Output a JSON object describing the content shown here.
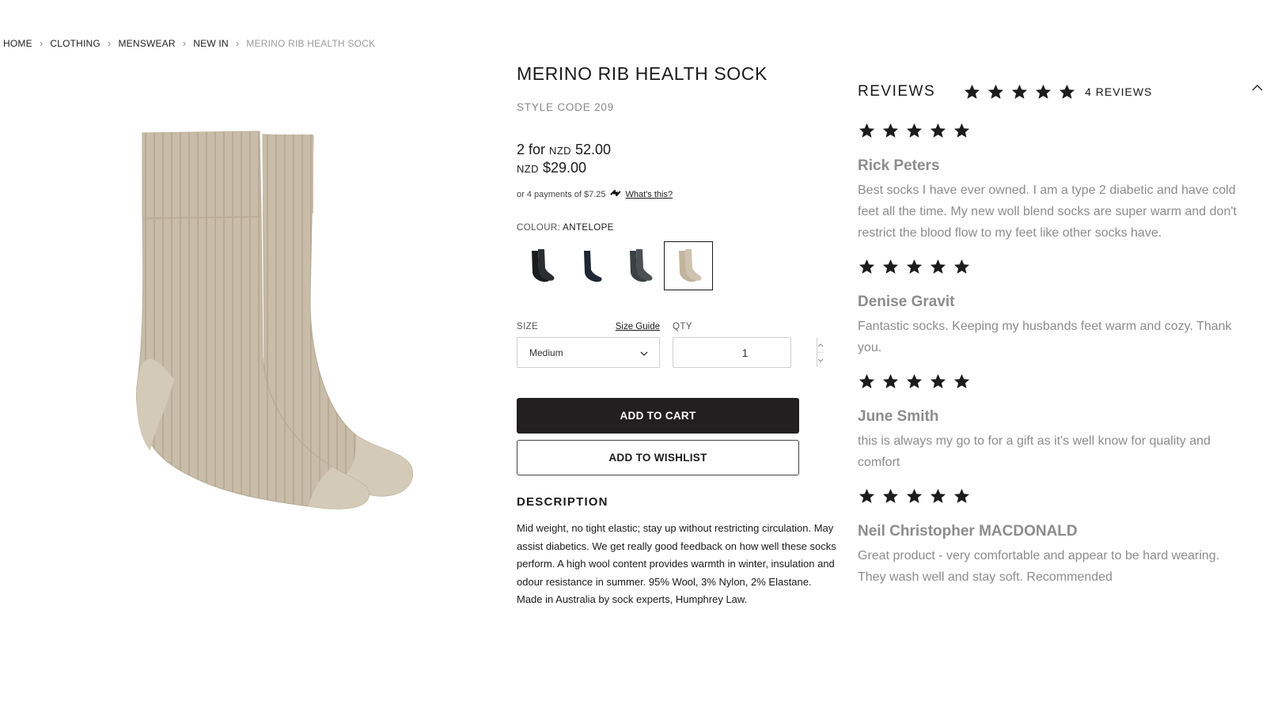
{
  "breadcrumb": {
    "items": [
      "HOME",
      "CLOTHING",
      "MENSWEAR",
      "NEW IN"
    ],
    "current": "MERINO RIB HEALTH SOCK"
  },
  "product": {
    "title": "MERINO RIB HEALTH SOCK",
    "style_code": "STYLE CODE 209",
    "multi_price_prefix": "2 for",
    "currency": "NZD",
    "multi_price": "52.00",
    "single_price": "$29.00",
    "afterpay_text": "or 4 payments of $7.25",
    "afterpay_link": "What's this?",
    "colour_label": "COLOUR:",
    "colour_value": "ANTELOPE",
    "swatches": [
      {
        "name": "Black",
        "color": "#1e2123"
      },
      {
        "name": "Navy",
        "color": "#232c3a"
      },
      {
        "name": "Charcoal",
        "color": "#3e4448"
      },
      {
        "name": "Antelope",
        "color": "#c8bba6",
        "selected": true
      }
    ],
    "size_label": "SIZE",
    "size_guide": "Size Guide",
    "size_value": "Medium",
    "qty_label": "QTY",
    "qty_value": "1",
    "add_to_cart": "ADD TO CART",
    "add_to_wishlist": "ADD TO WISHLIST",
    "description_title": "DESCRIPTION",
    "description": "Mid weight, no tight elastic; stay up without restricting circulation. May assist diabetics. We get really good feedback on how well these socks perform. A high wool content provides warmth in winter, insulation and odour resistance in summer. 95% Wool, 3% Nylon, 2% Elastane. Made in Australia by sock experts, Humphrey Law.",
    "image_color": "#c9bca8"
  },
  "reviews": {
    "title": "REVIEWS",
    "average_rating": 5,
    "count_label": "4 REVIEWS",
    "items": [
      {
        "rating": 5,
        "author": "Rick Peters",
        "text": "Best socks I have ever owned. I am a type 2 diabetic and have cold feet all the time. My new woll blend socks are super warm and don't restrict the blood flow to my feet like other socks have."
      },
      {
        "rating": 5,
        "author": "Denise Gravit",
        "text": "Fantastic socks. Keeping my husbands feet warm and cozy. Thank you."
      },
      {
        "rating": 5,
        "author": "June Smith",
        "text": "this is always my go to for a gift as it's well know for quality and comfort"
      },
      {
        "rating": 5,
        "author": "Neil Christopher MACDONALD",
        "text": "Great product - very comfortable and appear to be hard wearing. They wash well and stay soft. Recommended"
      }
    ]
  }
}
